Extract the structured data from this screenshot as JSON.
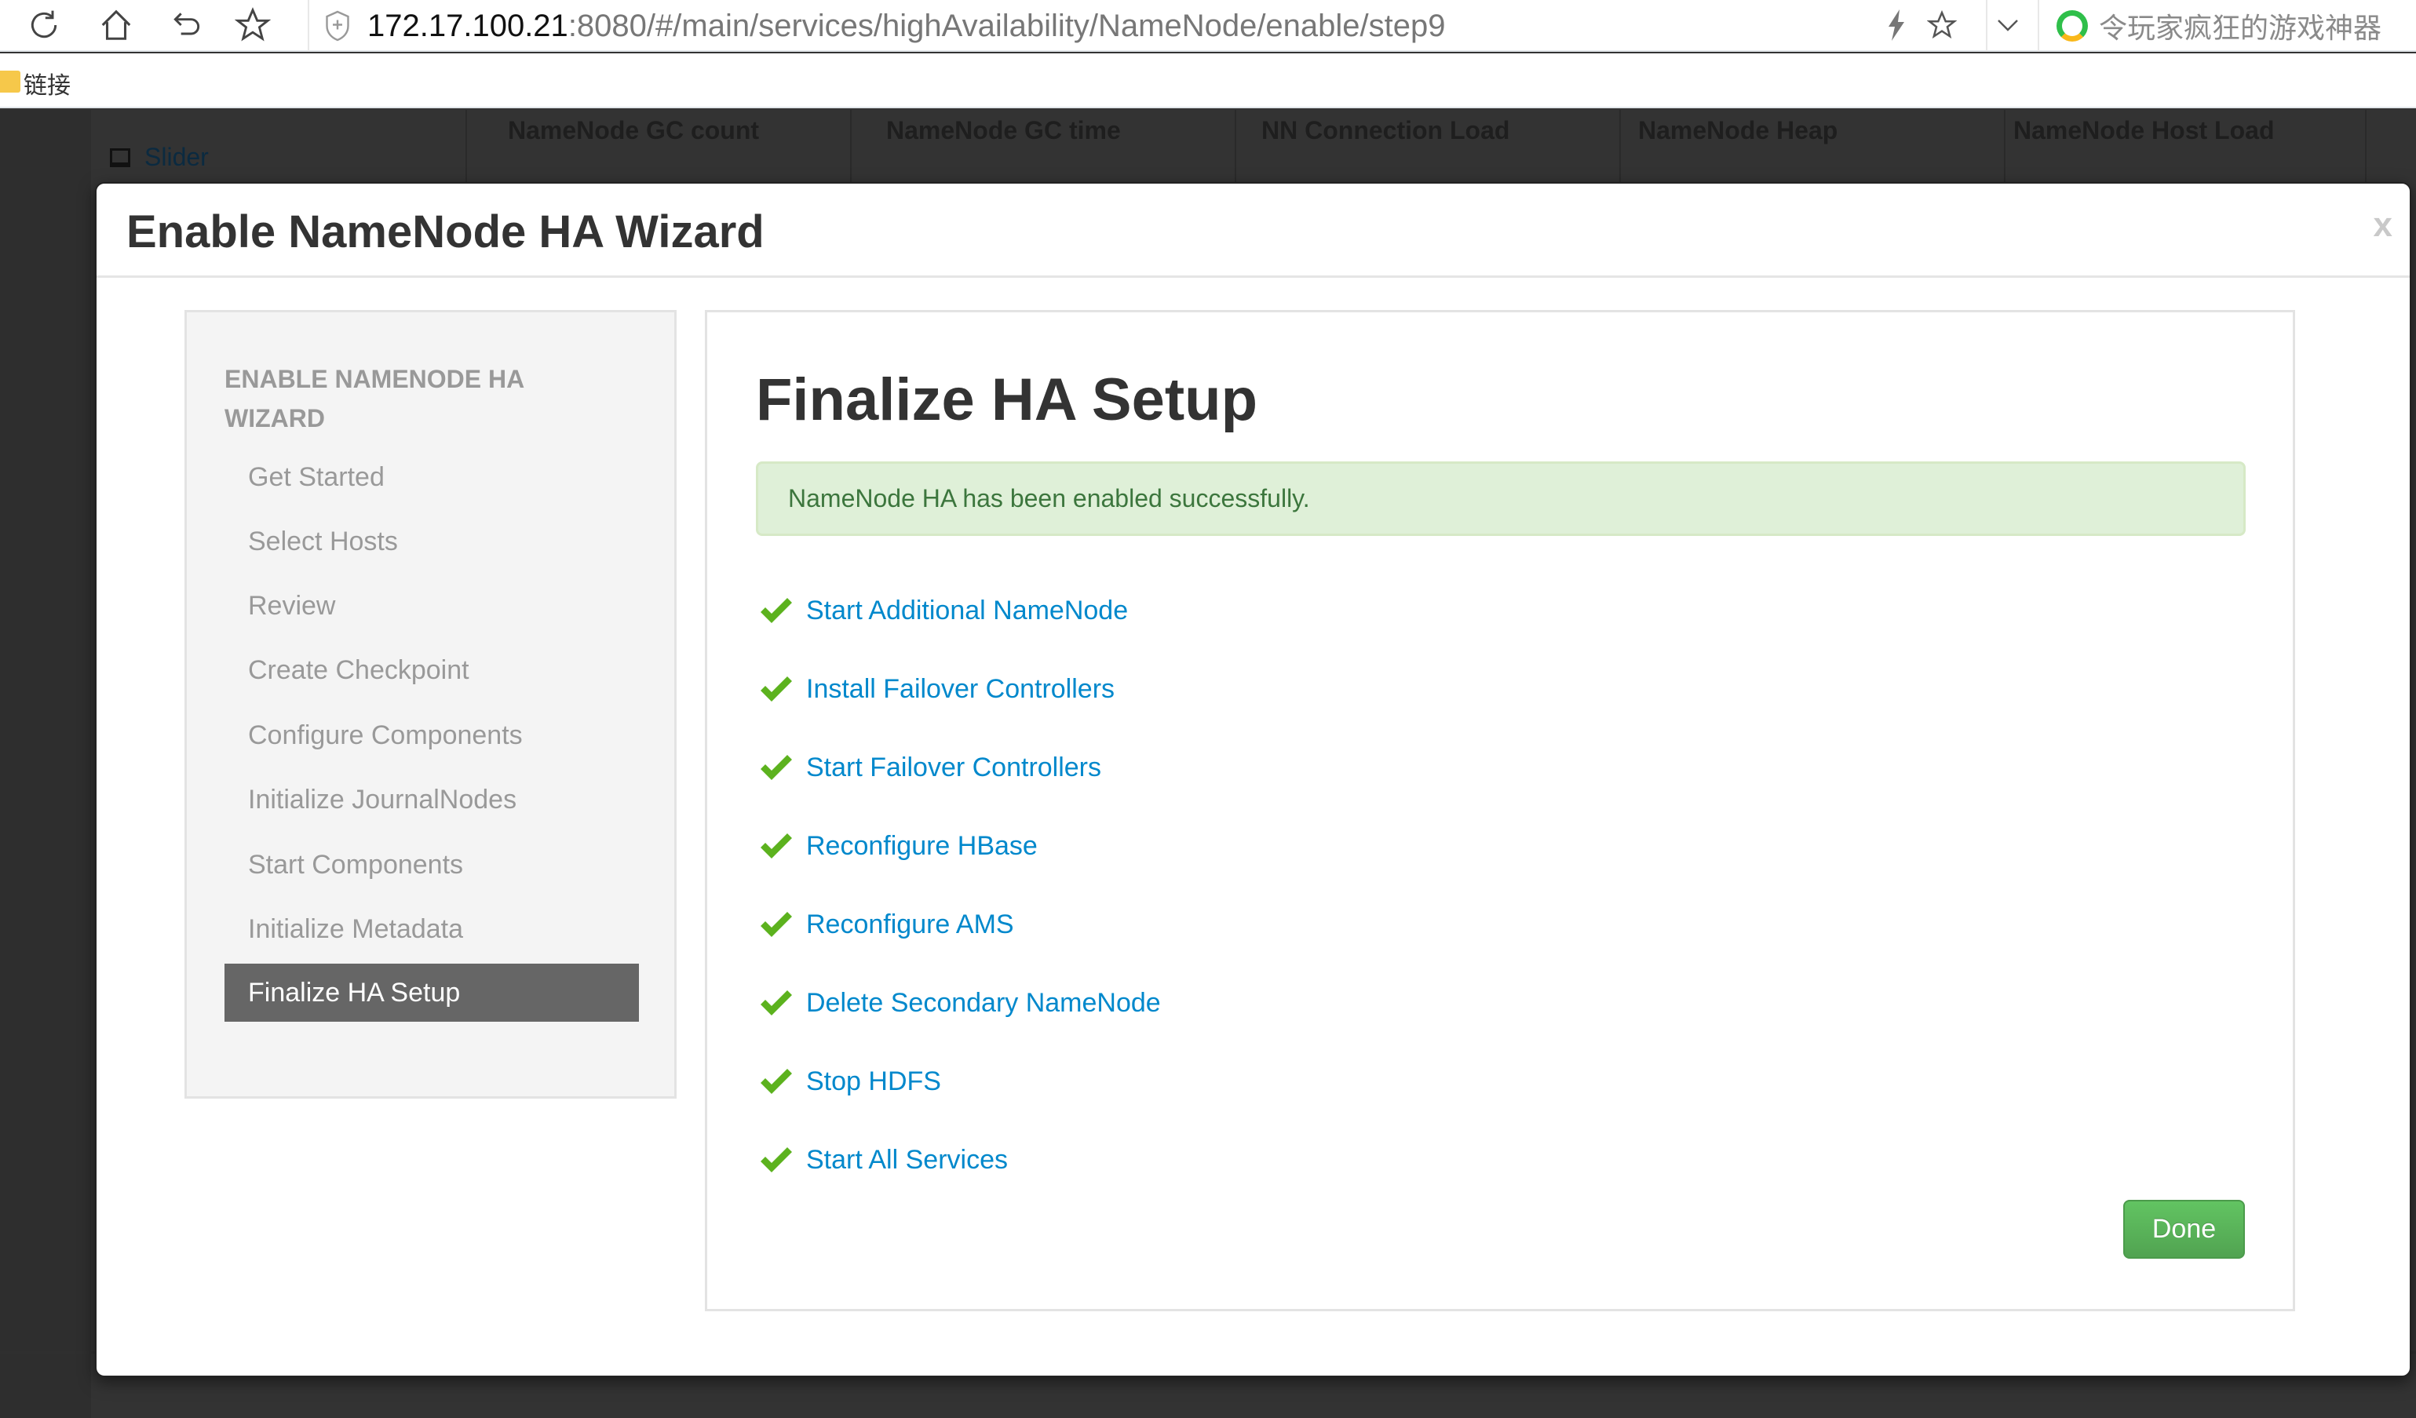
{
  "browser": {
    "url_host": "172.17.100.21",
    "url_rest": ":8080/#/main/services/highAvailability/NameNode/enable/step9",
    "search_suggestion": "令玩家疯狂的游戏神器",
    "bookmarks_label": "链接",
    "icons": [
      "reload-icon",
      "home-icon",
      "undo-icon",
      "star-icon",
      "shield-icon",
      "lightning-icon",
      "bookmark-star-icon",
      "chevron-down-icon"
    ]
  },
  "background": {
    "slider_label": "Slider",
    "columns": [
      "NameNode GC count",
      "NameNode GC time",
      "NN Connection Load",
      "NameNode Heap",
      "NameNode Host Load"
    ]
  },
  "modal": {
    "title": "Enable NameNode HA Wizard",
    "close_label": "x",
    "sidebar": {
      "heading": "ENABLE NAMENODE HA WIZARD",
      "steps": [
        {
          "label": "Get Started",
          "active": false
        },
        {
          "label": "Select Hosts",
          "active": false
        },
        {
          "label": "Review",
          "active": false
        },
        {
          "label": "Create Checkpoint",
          "active": false
        },
        {
          "label": "Configure Components",
          "active": false
        },
        {
          "label": "Initialize JournalNodes",
          "active": false
        },
        {
          "label": "Start Components",
          "active": false
        },
        {
          "label": "Initialize Metadata",
          "active": false
        },
        {
          "label": "Finalize HA Setup",
          "active": true
        }
      ]
    },
    "content": {
      "title": "Finalize HA Setup",
      "alert": "NameNode HA has been enabled successfully.",
      "tasks": [
        {
          "label": "Start Additional NameNode",
          "status": "completed"
        },
        {
          "label": "Install Failover Controllers",
          "status": "completed"
        },
        {
          "label": "Start Failover Controllers",
          "status": "completed"
        },
        {
          "label": "Reconfigure HBase",
          "status": "completed"
        },
        {
          "label": "Reconfigure AMS",
          "status": "completed"
        },
        {
          "label": "Delete Secondary NameNode",
          "status": "completed"
        },
        {
          "label": "Stop HDFS",
          "status": "completed"
        },
        {
          "label": "Start All Services",
          "status": "completed"
        }
      ],
      "done_label": "Done"
    }
  },
  "colors": {
    "link": "#0088cc",
    "check": "#5cb21e",
    "success_bg": "#dff0d8",
    "success_text": "#3c763d",
    "done_button": "#5bb75b",
    "active_step": "#666666"
  }
}
